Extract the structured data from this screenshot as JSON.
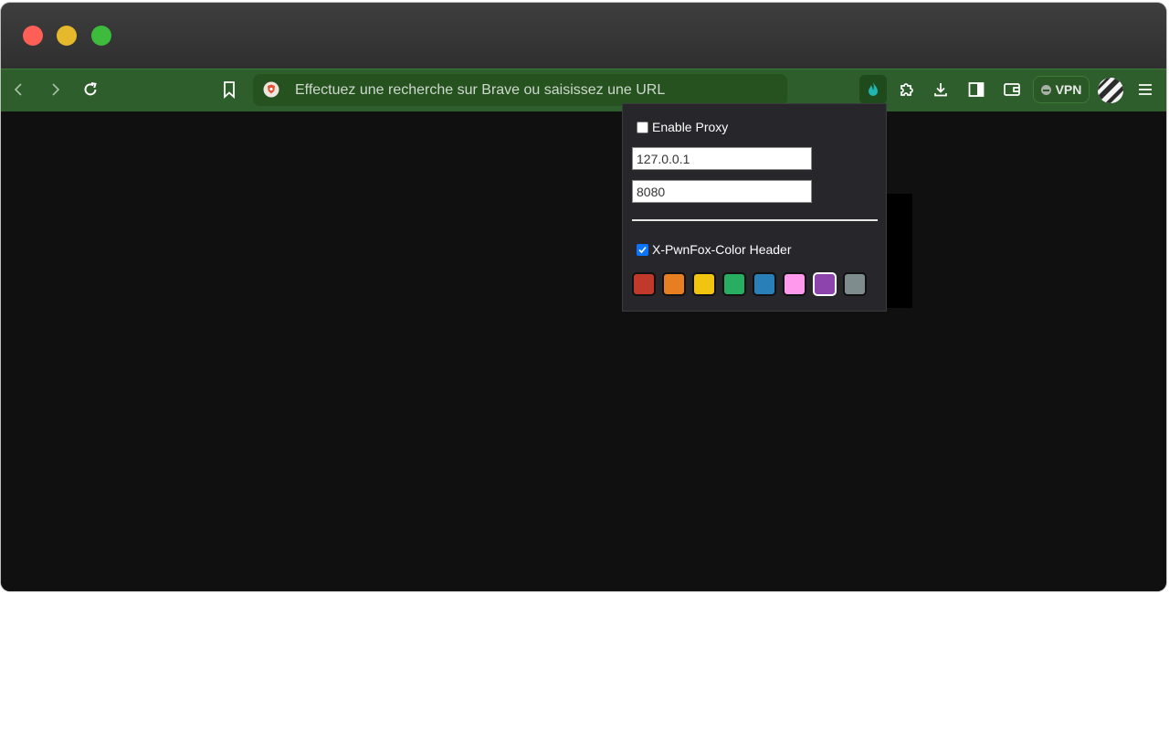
{
  "window": {
    "traffic_lights": [
      {
        "name": "close",
        "color": "#ff5f57"
      },
      {
        "name": "minimize",
        "color": "#e6b82b"
      },
      {
        "name": "maximize",
        "color": "#3dbb3d"
      }
    ]
  },
  "toolbar": {
    "back_icon": "chevron-left-icon",
    "forward_icon": "chevron-right-icon",
    "reload_icon": "reload-icon",
    "bookmark_icon": "bookmark-icon",
    "url_placeholder": "Effectuez une recherche sur Brave ou saisissez une URL",
    "extensions": [
      "pwnfox-icon",
      "puzzle-icon",
      "download-icon",
      "sidebar-icon",
      "wallet-icon"
    ],
    "vpn_label": "VPN",
    "menu_icon": "hamburger-icon",
    "accent_color": "#2e5e2b"
  },
  "popup": {
    "enable_proxy_label": "Enable Proxy",
    "enable_proxy_checked": false,
    "host_value": "127.0.0.1",
    "port_value": "8080",
    "header_label": "X-PwnFox-Color Header",
    "header_checked": true,
    "colors": [
      {
        "name": "red",
        "hex": "#c0392b",
        "selected": false
      },
      {
        "name": "orange",
        "hex": "#e67e22",
        "selected": false
      },
      {
        "name": "yellow",
        "hex": "#f1c40f",
        "selected": false
      },
      {
        "name": "green",
        "hex": "#27ae60",
        "selected": false
      },
      {
        "name": "blue",
        "hex": "#2980b9",
        "selected": false
      },
      {
        "name": "pink",
        "hex": "#ff99ee",
        "selected": false
      },
      {
        "name": "purple",
        "hex": "#8e44ad",
        "selected": true
      },
      {
        "name": "grey",
        "hex": "#7f8c8d",
        "selected": false
      }
    ]
  }
}
